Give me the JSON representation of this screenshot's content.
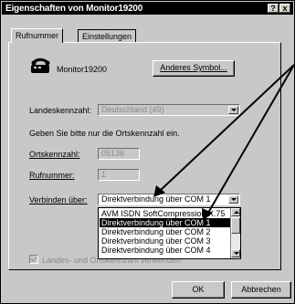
{
  "window": {
    "title": "Eigenschaften von Monitor19200",
    "help_icon": "?",
    "close_icon": "x"
  },
  "tabs": [
    "Rufnummer",
    "Einstellungen"
  ],
  "device": {
    "icon": "modem-phone-icon",
    "name": "Monitor19200",
    "change_icon_button": "Anderes Symbol..."
  },
  "form": {
    "country_label": "Landeskennzahl:",
    "country_value": "Deutschland (49)",
    "hint": "Geben Sie bitte nur die Ortskennzahl ein.",
    "area_code_label": "Ortskennzahl:",
    "area_code_value": "05136",
    "number_label": "Rufnummer:",
    "number_value": "1",
    "connect_label": "Verbinden über:",
    "connect_value": "Direktverbindung über COM 1",
    "options": [
      "AVM ISDN SoftCompression X.75",
      "Direktverbindung über COM 1",
      "Direktverbindung über COM 2",
      "Direktverbindung über COM 3",
      "Direktverbindung über COM 4"
    ],
    "selected_index": 1,
    "checkbox_label": "Landes- und Ortskennzahl verwenden",
    "checkbox_checked": true
  },
  "buttons": {
    "ok": "OK",
    "cancel": "Abbrechen"
  },
  "colors": {
    "dialog_bg": "#c8c8c8",
    "titlebar": "#000000",
    "selection": "#000000"
  }
}
